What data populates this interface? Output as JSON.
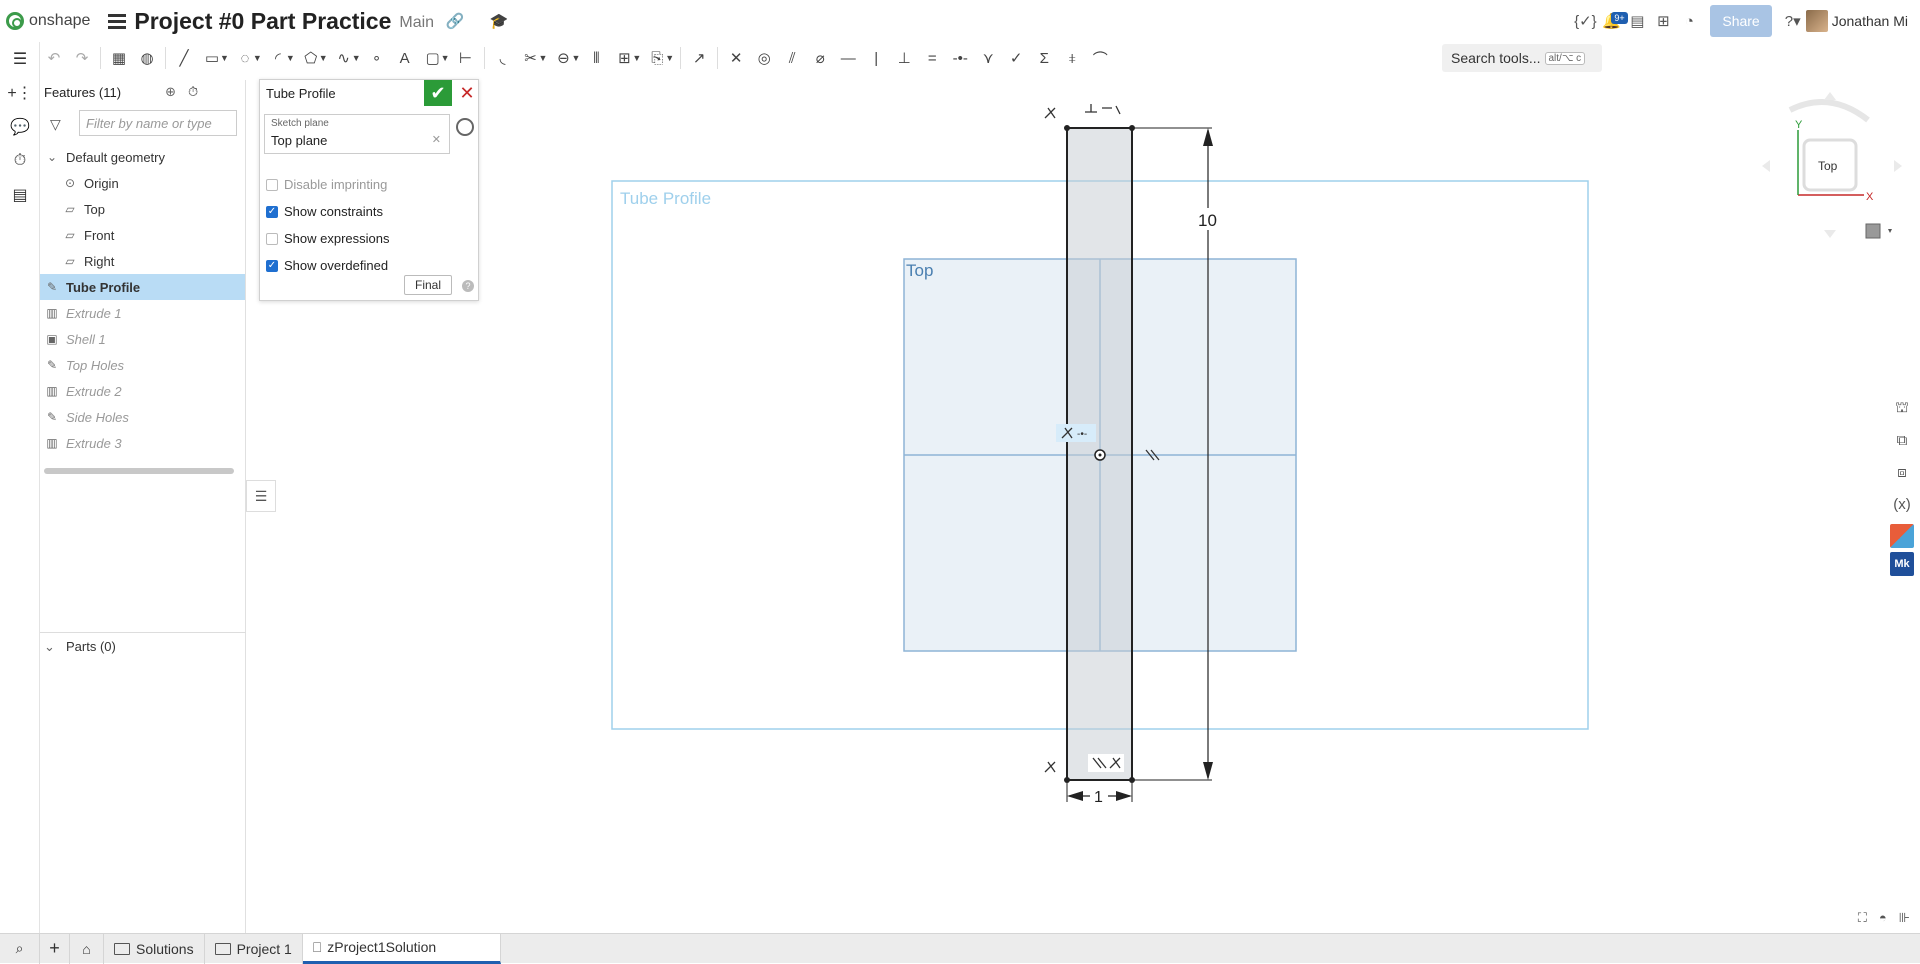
{
  "app": {
    "logo_text": "onshape",
    "document_title": "Project #0 Part Practice",
    "branch": "Main",
    "share_label": "Share",
    "notification_count": "9+",
    "user_name": "Jonathan Mi"
  },
  "toolbar": {
    "search_placeholder": "Search tools...",
    "search_shortcut": "alt/⌥ c",
    "icons": [
      "undo-icon",
      "redo-icon",
      "sketch-list-icon",
      "sketch-alt-icon",
      "line-icon",
      "rectangle-icon",
      "circle-icon",
      "arc-icon",
      "polygon-icon",
      "spline-icon",
      "point-icon",
      "text-icon",
      "construction-icon",
      "dimension-icon",
      "fillet-icon",
      "trim-icon",
      "slot-icon",
      "mirror-icon",
      "pattern-icon",
      "dxf-icon",
      "transform-icon",
      "coincident-icon",
      "concentric-icon",
      "parallel-icon",
      "tangent-icon",
      "horizontal-icon",
      "vertical-icon",
      "perpendicular-icon",
      "equal-icon",
      "midpoint-icon",
      "normal-icon",
      "pierce-icon",
      "symmetric-icon",
      "fix-icon",
      "curvature-icon"
    ]
  },
  "features": {
    "header": "Features (11)",
    "filter_placeholder": "Filter by name or type",
    "items": [
      {
        "label": "Default geometry",
        "type": "group"
      },
      {
        "label": "Origin",
        "type": "origin"
      },
      {
        "label": "Top",
        "type": "plane"
      },
      {
        "label": "Front",
        "type": "plane"
      },
      {
        "label": "Right",
        "type": "plane"
      },
      {
        "label": "Tube Profile",
        "type": "sketch",
        "state": "selected"
      },
      {
        "label": "Extrude 1",
        "type": "extrude",
        "state": "disabled"
      },
      {
        "label": "Shell 1",
        "type": "shell",
        "state": "disabled"
      },
      {
        "label": "Top Holes",
        "type": "sketch",
        "state": "disabled"
      },
      {
        "label": "Extrude 2",
        "type": "extrude",
        "state": "disabled"
      },
      {
        "label": "Side Holes",
        "type": "sketch",
        "state": "disabled"
      },
      {
        "label": "Extrude 3",
        "type": "extrude",
        "state": "disabled"
      }
    ],
    "parts_label": "Parts (0)"
  },
  "sketch_dialog": {
    "title": "Tube Profile",
    "plane_label": "Sketch plane",
    "plane_value": "Top plane",
    "options": [
      {
        "label": "Disable imprinting",
        "checked": false
      },
      {
        "label": "Show constraints",
        "checked": true
      },
      {
        "label": "Show expressions",
        "checked": false
      },
      {
        "label": "Show overdefined",
        "checked": true
      }
    ],
    "final_label": "Final"
  },
  "canvas": {
    "sketch_label": "Tube Profile",
    "plane_label": "Top",
    "dim_height": "10",
    "dim_width": "1"
  },
  "viewcube": {
    "face_label": "Top",
    "axis_x": "X",
    "axis_y": "Y"
  },
  "bottom_tabs": [
    {
      "label": "Solutions",
      "type": "folder"
    },
    {
      "label": "Project 1",
      "type": "folder"
    },
    {
      "label": "zProject1Solution",
      "type": "partstudio",
      "active": true
    }
  ],
  "colors": {
    "accent": "#1f5fb0",
    "ok_green": "#2b9b38",
    "selection": "#b9dcf5",
    "plane_blue": "#9fcbe6"
  }
}
